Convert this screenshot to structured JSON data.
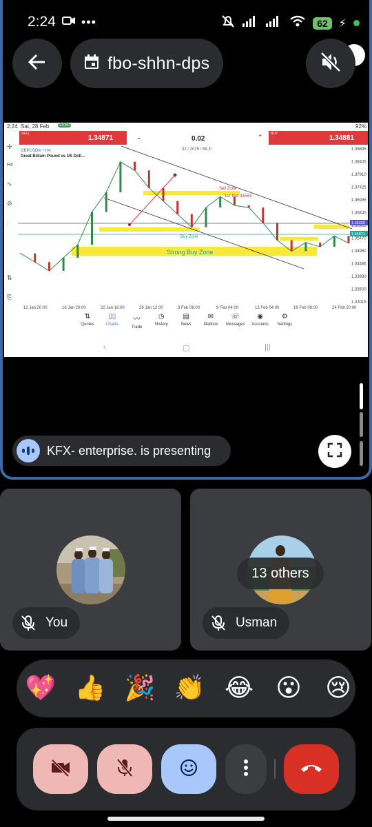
{
  "status_bar": {
    "time": "2:24",
    "battery": "62"
  },
  "meeting": {
    "code": "fbo-shhn-dps"
  },
  "presenting": {
    "text": "KFX- enterprise. is presenting"
  },
  "shared_screen": {
    "status_time": "2:24",
    "status_date": "Sat, 28 Feb",
    "status_badge": "23:50",
    "status_battery": "92%",
    "sell_label": "SELL",
    "sell_price": "1.34871",
    "buy_label": "BUY",
    "buy_price": "1.34881",
    "lot": "0.02",
    "symbol": "GBPUSDm • H4",
    "symbol_name": "Great Britain Pound vs US Doll...",
    "chart_info": "32 / 2025 / 89.3°",
    "annotations": {
      "sell_zone": "Sell Zone",
      "first_test": "1st Test 41563",
      "buy_zone": "Buy Zone",
      "strong_buy_zone": "Strong Buy Zone"
    },
    "left_tool_h4": "H4",
    "nav": [
      "Quotes",
      "Charts",
      "Trade",
      "History",
      "News",
      "Mailbox",
      "Messages",
      "Accounts",
      "Settings"
    ]
  },
  "chart_data": {
    "type": "line",
    "title": "GBPUSDm • H4",
    "subtitle": "Great Britain Pound vs US Doll...",
    "categories": [
      "12 Jan 20:00",
      "16 Jan 20:00",
      "22 Jan 16:00",
      "28 Jan 12:00",
      "3 Feb 08:00",
      "9 Feb 04:00",
      "13 Feb 04:00",
      "19 Feb 08:00",
      "24 Feb 20:00"
    ],
    "y_ticks": [
      "1.38895",
      "1.38405",
      "1.37910",
      "1.37425",
      "1.36935",
      "1.36445",
      "1.35955",
      "1.35470",
      "1.34980",
      "1.34486",
      "1.33990",
      "1.33500",
      "1.33015"
    ],
    "price_tags": [
      "1.35330",
      "1.34871"
    ],
    "series": [
      {
        "name": "",
        "x": [
          "12 Jan",
          "14 Jan",
          "16 Jan",
          "18 Jan",
          "20 Jan",
          "22 Jan",
          "24 Jan",
          "26 Jan",
          "28 Jan",
          "30 Jan",
          "1 Feb",
          "3 Feb",
          "5 Feb",
          "7 Feb",
          "9 Feb",
          "11 Feb",
          "13 Feb",
          "15 Feb",
          "17 Feb",
          "19 Feb",
          "21 Feb",
          "23 Feb",
          "25 Feb",
          "27 Feb"
        ],
        "values": [
          1.344,
          1.34,
          1.336,
          1.342,
          1.348,
          1.363,
          1.372,
          1.386,
          1.382,
          1.374,
          1.368,
          1.362,
          1.356,
          1.365,
          1.37,
          1.366,
          1.365,
          1.358,
          1.35,
          1.345,
          1.349,
          1.347,
          1.352,
          1.3487
        ]
      }
    ],
    "ylim": [
      1.33,
      1.39
    ],
    "grid": false
  }
}
